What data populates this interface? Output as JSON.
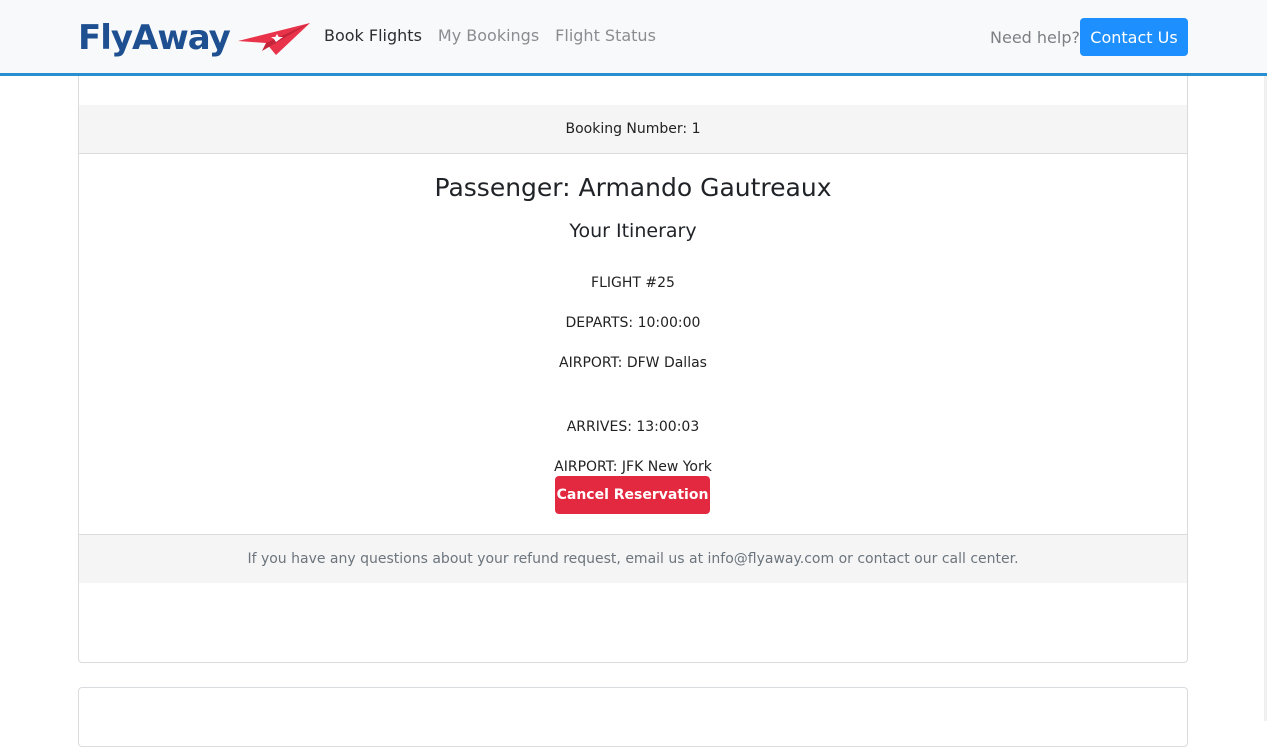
{
  "navbar": {
    "brand": "FlyAway",
    "links": [
      {
        "label": "Book Flights",
        "active": true
      },
      {
        "label": "My Bookings",
        "active": false
      },
      {
        "label": "Flight Status",
        "active": false
      }
    ],
    "help_text": "Need help?",
    "contact_label": "Contact Us"
  },
  "booking": {
    "header": "Booking Number: 1",
    "passenger": "Passenger: Armando Gautreaux",
    "itinerary_title": "Your Itinerary",
    "flight": "FLIGHT #25",
    "departs": "DEPARTS: 10:00:00",
    "depart_airport": "AIRPORT: DFW Dallas",
    "arrives": "ARRIVES: 13:00:03",
    "arrive_airport": "AIRPORT: JFK New York",
    "cancel_label": "Cancel Reservation",
    "footer": "If you have any questions about your refund request, email us at info@flyaway.com or contact our call center."
  },
  "colors": {
    "brand": "#1d4f91",
    "plane": "#e8334a",
    "accent": "#1e8fff",
    "danger": "#e3293f",
    "nav_border": "#2a8fd0"
  }
}
